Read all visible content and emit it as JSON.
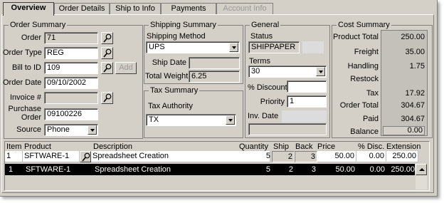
{
  "tabs": [
    "Overview",
    "Order Details",
    "Ship to Info",
    "Payments",
    "Account Info"
  ],
  "order_summary": {
    "title": "Order Summary",
    "order_label": "Order",
    "order_value": "71",
    "order_type_label": "Order Type",
    "order_type_value": "REG",
    "bill_to_label": "Bill to ID",
    "bill_to_value": "109",
    "add_label": "Add",
    "order_date_label": "Order Date",
    "order_date_value": "09/10/2002",
    "invoice_label": "Invoice #",
    "invoice_value": "",
    "po_label_1": "Purchase",
    "po_label_2": "Order",
    "po_value": "09100226",
    "source_label": "Source",
    "source_value": "Phone"
  },
  "shipping_summary": {
    "title": "Shipping Summary",
    "method_label": "Shipping Method",
    "method_value": "UPS",
    "ship_date_label": "Ship Date",
    "ship_date_value": "",
    "total_weight_label": "Total Weight",
    "total_weight_value": "6.25"
  },
  "tax_summary": {
    "title": "Tax Summary",
    "authority_label": "Tax Authority",
    "authority_value": "TX"
  },
  "general": {
    "title": "General",
    "status_label": "Status",
    "status_value": "SHIPPAPER",
    "terms_label": "Terms",
    "terms_value": "30",
    "discount_label": "% Discount",
    "discount_value": "",
    "priority_label": "Priority",
    "priority_value": "1",
    "inv_date_label": "Inv. Date",
    "inv_date_value": ""
  },
  "cost_summary": {
    "title": "Cost Summary",
    "product_total_label": "Product Total",
    "product_total_value": "250.00",
    "freight_label": "Freight",
    "freight_value": "35.00",
    "handling_label": "Handling",
    "handling_value": "1.75",
    "restock_label": "Restock",
    "restock_value": "",
    "tax_label": "Tax",
    "tax_value": "17.92",
    "order_total_label": "Order Total",
    "order_total_value": "304.67",
    "paid_label": "Paid",
    "paid_value": "304.67",
    "balance_label": "Balance",
    "balance_value": "0.00"
  },
  "items": {
    "headers": [
      "Item",
      "Product",
      "Description",
      "Quantity",
      "Ship",
      "Back",
      "Price",
      "% Disc.",
      "Extension"
    ],
    "rows": [
      [
        "1",
        "SFTWARE-1",
        "Spreadsheet Creation",
        "5",
        "2",
        "3",
        "50.00",
        "0.00",
        "250.00"
      ],
      [
        "1",
        "SFTWARE-1",
        "Spreadsheet Creation",
        "5",
        "2",
        "3",
        "50.00",
        "0.00",
        "250.00"
      ]
    ]
  }
}
